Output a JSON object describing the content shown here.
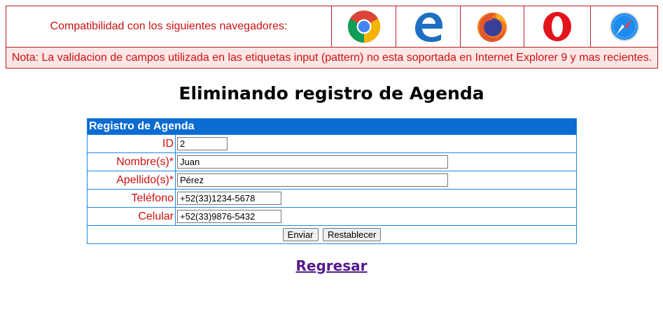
{
  "banner": {
    "compat_text": "Compatibilidad con los siguientes navegadores:",
    "browsers": [
      "chrome-icon",
      "edge-icon",
      "firefox-icon",
      "opera-icon",
      "safari-icon"
    ],
    "note": "Nota: La validacion de campos utilizada en las etiquetas input (pattern) no esta soportada en Internet Explorer 9 y mas recientes."
  },
  "page": {
    "title": "Eliminando registro de Agenda"
  },
  "form": {
    "header": "Registro de Agenda",
    "fields": [
      {
        "label": "ID",
        "value": "2"
      },
      {
        "label": "Nombre(s)*",
        "value": "Juan"
      },
      {
        "label": "Apellido(s)*",
        "value": "Pérez"
      },
      {
        "label": "Teléfono",
        "value": "+52(33)1234-5678"
      },
      {
        "label": "Celular",
        "value": "+52(33)9876-5432"
      }
    ],
    "submit_label": "Enviar",
    "reset_label": "Restablecer"
  },
  "back_link": "Regresar",
  "colors": {
    "banner_text": "#cc1111",
    "banner_border": "#b22222",
    "note_bg": "#fde6e6",
    "form_header_bg": "#0a6bd0",
    "form_border": "#1e88e5",
    "label_text": "#cc1111",
    "link_visited": "#551a8b"
  }
}
